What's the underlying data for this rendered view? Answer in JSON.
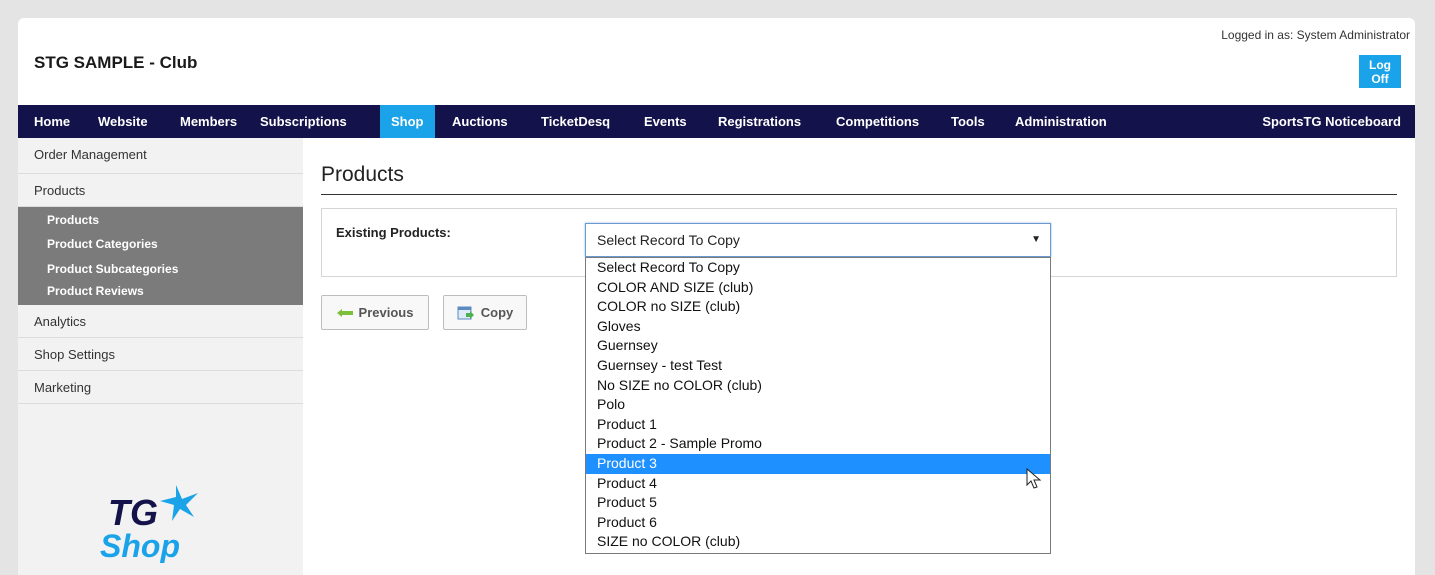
{
  "header": {
    "club_title": "STG SAMPLE - Club",
    "logged_in_text": "Logged in as: System Administrator",
    "logoff_label": "Log Off"
  },
  "nav": {
    "items": [
      {
        "label": "Home"
      },
      {
        "label": "Website"
      },
      {
        "label": "Members"
      },
      {
        "label": "Subscriptions"
      },
      {
        "label": "Shop",
        "active": true
      },
      {
        "label": "Auctions"
      },
      {
        "label": "TicketDesq"
      },
      {
        "label": "Events"
      },
      {
        "label": "Registrations"
      },
      {
        "label": "Competitions"
      },
      {
        "label": "Tools"
      },
      {
        "label": "Administration"
      }
    ],
    "right_item": "SportsTG Noticeboard"
  },
  "sidebar": {
    "items": [
      {
        "label": "Order Management"
      },
      {
        "label": "Products"
      }
    ],
    "sub_items": [
      {
        "label": "Products"
      },
      {
        "label": "Product Categories"
      },
      {
        "label": "Product Subcategories"
      },
      {
        "label": "Product Reviews"
      }
    ],
    "items_after": [
      {
        "label": "Analytics"
      },
      {
        "label": "Shop Settings"
      },
      {
        "label": "Marketing"
      }
    ],
    "logo": {
      "line1": "TG",
      "line2": "Shop"
    }
  },
  "main": {
    "page_title": "Products",
    "existing_label": "Existing Products:",
    "select_value": "Select Record To Copy",
    "options": [
      "Select Record To Copy",
      "COLOR AND SIZE (club)",
      "COLOR no SIZE (club)",
      "Gloves",
      "Guernsey",
      "Guernsey - test Test",
      "No SIZE no COLOR (club)",
      "Polo",
      "Product 1",
      "Product 2 - Sample Promo",
      "Product 3",
      "Product 4",
      "Product 5",
      "Product 6",
      "SIZE no COLOR (club)"
    ],
    "highlighted_option": "Product 3",
    "previous_label": "Previous",
    "copy_label": "Copy"
  },
  "colors": {
    "nav_bg": "#13124a",
    "accent": "#1aa3e8",
    "highlight": "#1e90ff"
  }
}
